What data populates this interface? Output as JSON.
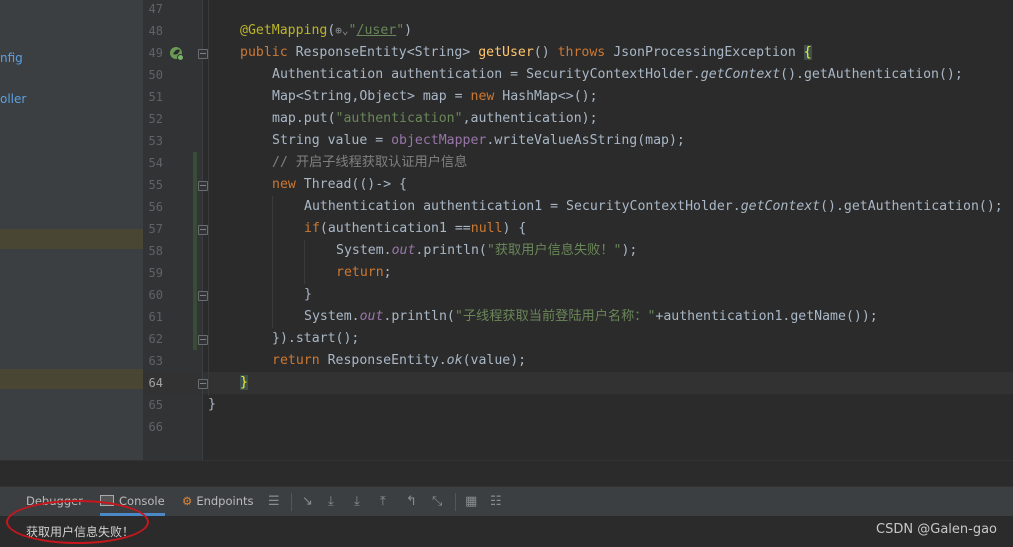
{
  "sidebar": {
    "items": [
      "nfig",
      "oller"
    ]
  },
  "gutter": {
    "line_numbers": [
      "47",
      "48",
      "49",
      "50",
      "51",
      "52",
      "53",
      "54",
      "55",
      "56",
      "57",
      "58",
      "59",
      "60",
      "61",
      "62",
      "63",
      "64",
      "65",
      "66"
    ],
    "current_line": "64"
  },
  "code": {
    "l48": {
      "annotation": "@GetMapping",
      "open": "(",
      "icon": "globe-icon",
      "q1": "\"",
      "path": "/user",
      "q2": "\"",
      "close": ")"
    },
    "l49": {
      "kw_public": "public ",
      "type": "ResponseEntity<String> ",
      "method": "getUser",
      "parens": "() ",
      "kw_throws": "throws ",
      "exc": "JsonProcessingException ",
      "brace": "{"
    },
    "l50": {
      "a": "Authentication authentication = SecurityContextHolder.",
      "b": "getContext",
      "c": "().getAuthentication();"
    },
    "l51": {
      "a": "Map<String,Object> map = ",
      "kw": "new ",
      "b": "HashMap<>();"
    },
    "l52": {
      "a": "map.put(",
      "str": "\"authentication\"",
      "b": ",authentication);"
    },
    "l53": {
      "a": "String value = ",
      "field": "objectMapper",
      "b": ".writeValueAsString(map);"
    },
    "l54": {
      "comment": "// 开启子线程获取认证用户信息"
    },
    "l55": {
      "kw": "new ",
      "a": "Thread(()-> {"
    },
    "l56": {
      "a": "Authentication authentication1 = SecurityContextHolder.",
      "b": "getContext",
      "c": "().getAuthentication();"
    },
    "l57": {
      "kw": "if",
      "a": "(authentication1 ==",
      "kw2": "null",
      "b": ") {"
    },
    "l58": {
      "a": "System.",
      "field": "out",
      "b": ".println(",
      "str": "\"获取用户信息失败！\"",
      "c": ");"
    },
    "l59": {
      "kw": "return",
      "a": ";"
    },
    "l60": {
      "a": "}"
    },
    "l61": {
      "a": "System.",
      "field": "out",
      "b": ".println(",
      "str": "\"子线程获取当前登陆用户名称：\"",
      "c": "+authentication1.getName());"
    },
    "l62": {
      "a": "}).start();"
    },
    "l63": {
      "kw": "return ",
      "a": "ResponseEntity.",
      "b": "ok",
      "c": "(value);"
    },
    "l64": {
      "a": "}"
    },
    "l65": {
      "a": "}"
    }
  },
  "toolbar": {
    "tabs": [
      "Debugger",
      "Console",
      "Endpoints"
    ],
    "active_tab": "Console"
  },
  "console": {
    "output": "获取用户信息失败！"
  },
  "watermark": "CSDN @Galen-gao",
  "colors": {
    "annotation_ellipse": "#c8161d",
    "keyword": "#cc7832",
    "string": "#6a8759",
    "method_decl": "#ffc66d"
  }
}
